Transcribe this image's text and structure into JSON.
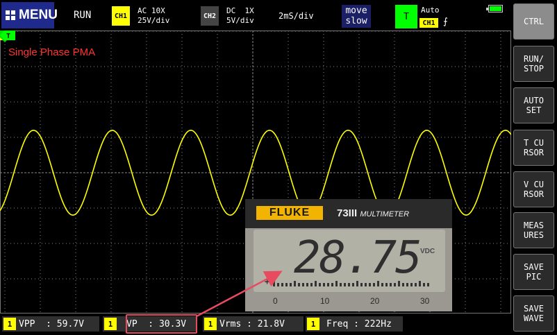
{
  "header": {
    "menu_label": "MENU",
    "run_state": "RUN",
    "ch1": {
      "badge": "CH1",
      "coupling": "AC 10X",
      "scale": "25V/div"
    },
    "ch2": {
      "badge": "CH2",
      "coupling": "DC  1X",
      "scale": "5V/div"
    },
    "timebase": "2mS/div",
    "move": {
      "line1": "move",
      "line2": "slow"
    },
    "trigger": {
      "badge": "T",
      "mode": "Auto",
      "source": "CH1",
      "edge_icon": "rising-edge-icon"
    },
    "battery_icon": "battery-full-icon"
  },
  "scope": {
    "title": "Single Phase PMA",
    "channel_marker": "1",
    "trigger_marker": "T",
    "waveform": {
      "cycles_visible": 6.5,
      "amplitude_divisions": 1.2,
      "color": "#ffff00"
    }
  },
  "sidebar": {
    "buttons": [
      {
        "line1": "CTRL",
        "line2": ""
      },
      {
        "line1": "RUN/",
        "line2": "STOP"
      },
      {
        "line1": "AUTO",
        "line2": "SET"
      },
      {
        "line1": "T CU",
        "line2": "RSOR"
      },
      {
        "line1": "V CU",
        "line2": "RSOR"
      },
      {
        "line1": "MEAS",
        "line2": "URES"
      },
      {
        "line1": "SAVE",
        "line2": "PIC"
      },
      {
        "line1": "SAVE",
        "line2": "WAVE"
      }
    ]
  },
  "measurements": [
    {
      "ch": "1",
      "text": "VPP  : 59.7V"
    },
    {
      "ch": "1",
      "text": "VP  : 30.3V"
    },
    {
      "ch": "1",
      "text": "Vrms : 21.8V"
    },
    {
      "ch": "1",
      "text": "Freq : 222Hz"
    }
  ],
  "meter": {
    "brand": "FLUKE",
    "model": "73III",
    "model_suffix": "MULTIMETER",
    "reading": "28.75",
    "unit": "VDC",
    "scale": [
      "0",
      "10",
      "20",
      "30"
    ]
  },
  "colors": {
    "accent_yellow": "#ffff00",
    "trigger_green": "#00ff00",
    "title_red": "#ff3333",
    "callout": "#e84a5f"
  }
}
